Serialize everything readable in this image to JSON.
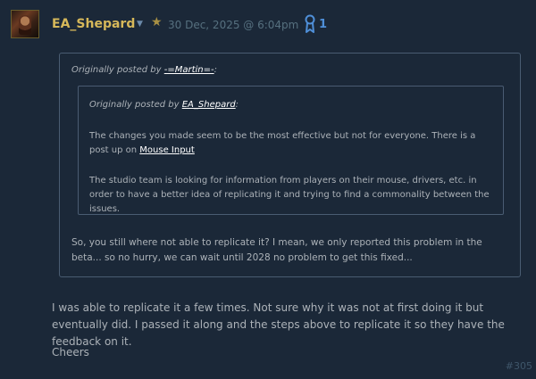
{
  "post": {
    "author": "EA_Shepard",
    "timestamp": "30 Dec, 2025 @ 6:04pm",
    "award_count": "1",
    "number": "#305"
  },
  "icons": {
    "dropdown": "chevron-down-icon",
    "star": "star-icon",
    "award": "award-ribbon-icon"
  },
  "outer_quote": {
    "prefix": "Originally posted by ",
    "user": "-=Martin=-",
    "suffix": ":",
    "text": "So, you still where not able to replicate it? I mean, we only reported this problem in the beta... so no hurry, we can wait until 2028 no problem to get this fixed..."
  },
  "inner_quote": {
    "prefix": "Originally posted by ",
    "user": "EA_Shepard",
    "suffix": ":",
    "para1_text": "The changes you made seem to be the most effective but not for everyone. There is a post up on ",
    "para1_link": "Mouse Input",
    "para2": "The studio team is looking for information from players on their mouse, drivers, etc. in order to have a better idea of replicating it and trying to find a commonality between the issues."
  },
  "reply": {
    "body": "I was able to replicate it a few times. Not sure why it was not at first doing it but eventually did. I passed it along and the steps above to replicate it so they have the feedback on it.",
    "signoff": "Cheers"
  },
  "colors": {
    "background": "#1b2838",
    "author": "#d6b85a",
    "text": "#acb2b8",
    "border": "#4a5c72",
    "award": "#4f8fd8"
  }
}
